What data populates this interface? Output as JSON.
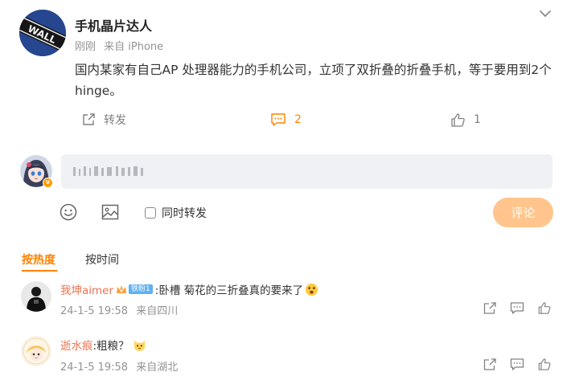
{
  "post": {
    "author": "手机晶片达人",
    "time": "刚刚",
    "source": "来自 iPhone",
    "text": "国内某家有自己AP 处理器能力的手机公司，立项了双折叠的折叠手机，等于要用到2个hinge。",
    "avatar_sign_text": "WALL"
  },
  "actions": {
    "forward_label": "转发",
    "comment_count": "2",
    "like_count": "1"
  },
  "composer": {
    "also_forward_label": "同时转发",
    "submit_label": "评论",
    "self_badge": "v"
  },
  "sort_tabs": {
    "hot": "按热度",
    "time": "按时间"
  },
  "comments": [
    {
      "user": "我坤aimer",
      "fan_badge": "铁粉1",
      "text": ":卧槽 菊花的三折叠真的要来了",
      "time": "24-1-5 19:58",
      "location": "来自四川"
    },
    {
      "user": "逝水痕",
      "text": ":粗粮？",
      "time": "24-1-5 19:58",
      "location": "来自湖北"
    }
  ],
  "colors": {
    "accent": "#ff8200",
    "username": "#eb7350",
    "submit_disabled": "#ffc58c",
    "input_bg": "#f0f1f4"
  }
}
